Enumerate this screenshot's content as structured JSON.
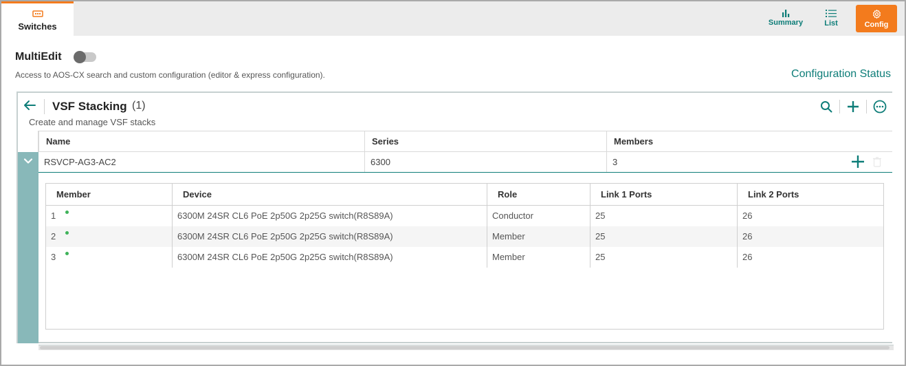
{
  "header": {
    "active_tab": {
      "label": "Switches",
      "icon": "switch-icon"
    },
    "views": [
      {
        "label": "Summary",
        "icon": "bar-chart-icon"
      },
      {
        "label": "List",
        "icon": "list-icon"
      },
      {
        "label": "Config",
        "icon": "gear-icon"
      }
    ]
  },
  "multiedit": {
    "label": "MultiEdit",
    "enabled": false,
    "description": "Access to AOS-CX search and custom configuration (editor & express configuration).",
    "config_status_link": "Configuration Status"
  },
  "panel": {
    "title": "VSF Stacking",
    "count": "(1)",
    "subtitle": "Create and manage VSF stacks",
    "columns": [
      "Name",
      "Series",
      "Members"
    ],
    "rows": [
      {
        "name": "RSVCP-AG3-AC2",
        "series": "6300",
        "members": "3"
      }
    ]
  },
  "members_table": {
    "columns": [
      "Member",
      "Device",
      "Role",
      "Link 1 Ports",
      "Link 2 Ports"
    ],
    "rows": [
      {
        "member": "1",
        "device": "6300M 24SR CL6 PoE 2p50G 2p25G switch(R8S89A)",
        "role": "Conductor",
        "link1": "25",
        "link2": "26"
      },
      {
        "member": "2",
        "device": "6300M 24SR CL6 PoE 2p50G 2p25G switch(R8S89A)",
        "role": "Member",
        "link1": "25",
        "link2": "26"
      },
      {
        "member": "3",
        "device": "6300M 24SR CL6 PoE 2p50G 2p25G switch(R8S89A)",
        "role": "Member",
        "link1": "25",
        "link2": "26"
      }
    ]
  },
  "colors": {
    "accent": "#0d7d78",
    "brand_orange": "#f37b1d",
    "status_up": "#3fb35a"
  }
}
